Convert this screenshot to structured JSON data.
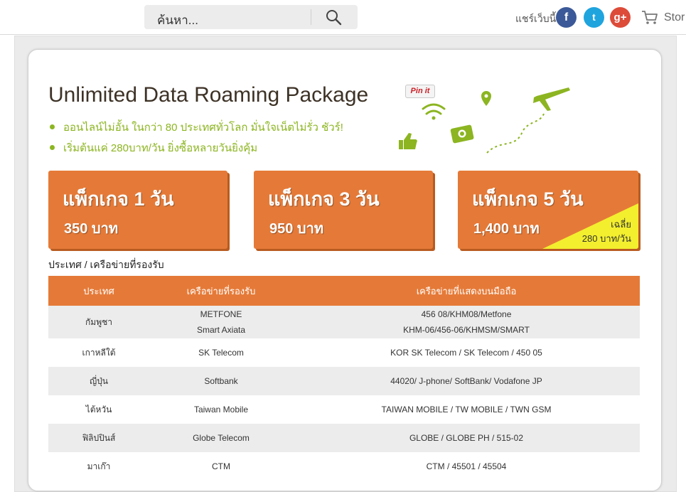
{
  "header": {
    "search_placeholder": "ค้นหา...",
    "share_label": "แชร์เว็บนี้",
    "store_label": "Stor",
    "social": {
      "facebook": "f",
      "twitter": "t",
      "googleplus": "g+"
    }
  },
  "hero": {
    "title": "Unlimited Data Roaming Package",
    "pinit": "Pin it",
    "bullets": [
      "ออนไลน์ไม่อั้น ในกว่า 80 ประเทศทั่วโลก มั่นใจเน็ตไม่รั่ว ชัวร์!",
      "เริ่มต้นแค่ 280บาท/วัน ยิ่งซื้อหลายวันยิ่งคุ้ม"
    ]
  },
  "packages": [
    {
      "title": "แพ็กเกจ 1 วัน",
      "price": "350 บาท"
    },
    {
      "title": "แพ็กเกจ 3 วัน",
      "price": "950 บาท"
    },
    {
      "title": "แพ็กเกจ 5 วัน",
      "price": "1,400 บาท",
      "avg_label": "เฉลี่ย",
      "avg_value": "280 บาท/วัน"
    }
  ],
  "table": {
    "caption": "ประเทศ / เครือข่ายที่รองรับ",
    "headers": [
      "ประเทศ",
      "เครือข่ายที่รองรับ",
      "เครือข่ายที่แสดงบนมือถือ"
    ],
    "rows": [
      {
        "country": "กัมพูชา",
        "networks": [
          "METFONE",
          "Smart Axiata"
        ],
        "display": [
          "456 08/KHM08/Metfone",
          "KHM-06/456-06/KHMSM/SMART"
        ]
      },
      {
        "country": "เกาหลีใต้",
        "networks": [
          "SK Telecom"
        ],
        "display": [
          "KOR SK Telecom / SK Telecom / 450 05"
        ]
      },
      {
        "country": "ญี่ปุ่น",
        "networks": [
          "Softbank"
        ],
        "display": [
          "44020/ J-phone/ SoftBank/ Vodafone JP"
        ]
      },
      {
        "country": "ไต้หวัน",
        "networks": [
          "Taiwan Mobile"
        ],
        "display": [
          "TAIWAN MOBILE / TW MOBILE / TWN GSM"
        ]
      },
      {
        "country": "ฟิลิปปินส์",
        "networks": [
          "Globe Telecom"
        ],
        "display": [
          "GLOBE / GLOBE PH / 515-02"
        ]
      },
      {
        "country": "มาเก๊า",
        "networks": [
          "CTM"
        ],
        "display": [
          "CTM / 45501 / 45504"
        ]
      }
    ]
  },
  "colors": {
    "accent": "#e57a38",
    "bullet": "#8cb521",
    "highlight": "#f3ef2e",
    "row_alt": "#ececec"
  }
}
